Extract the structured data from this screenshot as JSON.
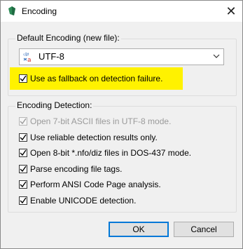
{
  "window": {
    "title": "Encoding",
    "close_icon": "close-icon"
  },
  "default_group": {
    "legend": "Default Encoding (new file):",
    "select_value": "UTF-8",
    "select_icon": "encoding-icon"
  },
  "fallback": {
    "label": "Use as fallback on detection failure.",
    "checked": true,
    "highlight_color": "#fff200"
  },
  "detection_group": {
    "legend": "Encoding Detection:",
    "options": [
      {
        "label": "Open 7-bit ASCII files in UTF-8 mode.",
        "checked": true,
        "disabled": true
      },
      {
        "label": "Use reliable detection results only.",
        "checked": true,
        "disabled": false
      },
      {
        "label": "Open 8-bit *.nfo/diz files in DOS-437 mode.",
        "checked": true,
        "disabled": false
      },
      {
        "label": "Parse encoding file tags.",
        "checked": true,
        "disabled": false
      },
      {
        "label": "Perform ANSI Code Page analysis.",
        "checked": true,
        "disabled": false
      },
      {
        "label": "Enable UNICODE detection.",
        "checked": true,
        "disabled": false
      }
    ]
  },
  "buttons": {
    "ok": "OK",
    "cancel": "Cancel",
    "accent": "#0078d7"
  }
}
